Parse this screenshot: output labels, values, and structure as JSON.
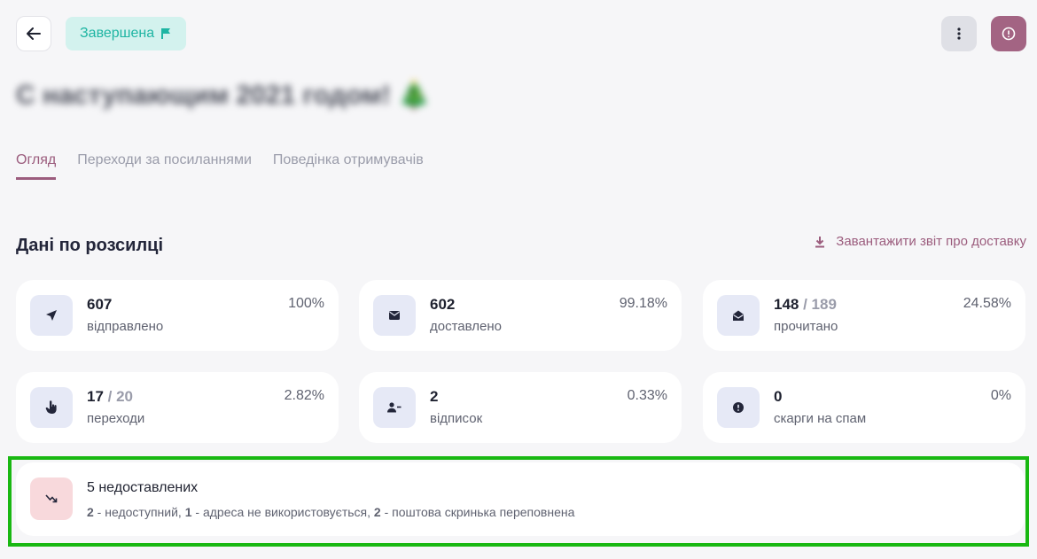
{
  "header": {
    "status_label": "Завершена",
    "title": "С наступающим 2021 годом! 🎄"
  },
  "tabs": [
    {
      "label": "Огляд",
      "active": true
    },
    {
      "label": "Переходи за посиланнями",
      "active": false
    },
    {
      "label": "Поведінка отримувачів",
      "active": false
    }
  ],
  "section": {
    "title": "Дані по розсилці",
    "download_label": "Завантажити звіт про доставку"
  },
  "stats": [
    {
      "icon": "send-icon",
      "value": "607",
      "secondary": "",
      "label": "відправлено",
      "pct": "100%"
    },
    {
      "icon": "envelope-icon",
      "value": "602",
      "secondary": "",
      "label": "доставлено",
      "pct": "99.18%"
    },
    {
      "icon": "open-envelope-icon",
      "value": "148",
      "secondary": "/ 189",
      "label": "прочитано",
      "pct": "24.58%"
    },
    {
      "icon": "pointer-hand-icon",
      "value": "17",
      "secondary": "/ 20",
      "label": "переходи",
      "pct": "2.82%"
    },
    {
      "icon": "user-minus-icon",
      "value": "2",
      "secondary": "",
      "label": "відписок",
      "pct": "0.33%"
    },
    {
      "icon": "alert-circle-icon",
      "value": "0",
      "secondary": "",
      "label": "скарги на спам",
      "pct": "0%"
    }
  ],
  "undelivered": {
    "title": "5 недоставлених",
    "items": [
      {
        "count": "2",
        "text": " - недоступний, "
      },
      {
        "count": "1",
        "text": " - адреса не використовується, "
      },
      {
        "count": "2",
        "text": " - поштова скринька переповнена"
      }
    ]
  },
  "colors": {
    "accent": "#9b5c7d",
    "status_bg": "#d3f2ee",
    "status_fg": "#1fb5a3",
    "highlight": "#19b812",
    "icon_bg": "#e6e9f6",
    "error_bg": "#f8d9dc"
  }
}
